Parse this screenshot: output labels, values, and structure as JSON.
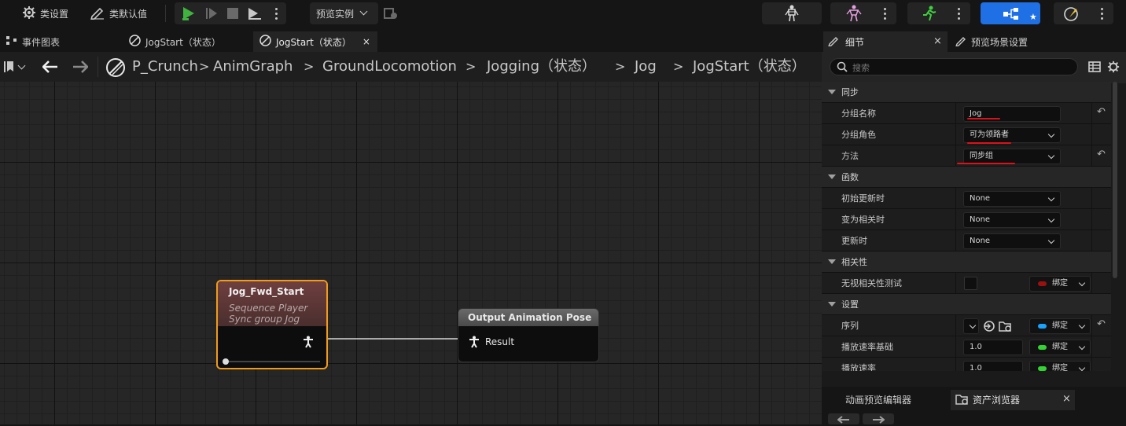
{
  "toolbar": {
    "class_settings": "类设置",
    "class_defaults": "类默认值",
    "preview_instance": "预览实例"
  },
  "tabs": {
    "event_graph": "事件图表",
    "tab1": "JogStart（状态）",
    "tab2": "JogStart（状态）",
    "tab2_close": "×"
  },
  "breadcrumb": {
    "items": [
      "P_Crunch",
      "AnimGraph",
      "GroundLocomotion",
      "Jogging（状态）",
      "Jog",
      "JogStart（状态）"
    ],
    "separator": ">"
  },
  "graph": {
    "node_player": {
      "title": "Jog_Fwd_Start",
      "subtitle1": "Sequence Player",
      "subtitle2": "Sync group Jog"
    },
    "node_output": {
      "title": "Output Animation Pose",
      "pin": "Result"
    }
  },
  "details": {
    "tab_details": "细节",
    "tab_close": "×",
    "tab_preview": "预览场景设置",
    "search_placeholder": "搜索",
    "sections": {
      "sync": "同步",
      "functions": "函数",
      "relevancy": "相关性",
      "settings": "设置"
    },
    "rows": {
      "group_name": {
        "label": "分组名称",
        "value": "Jog"
      },
      "group_role": {
        "label": "分组角色",
        "value": "可为领路者"
      },
      "method": {
        "label": "方法",
        "value": "同步组"
      },
      "on_initial_update": {
        "label": "初始更新时",
        "value": "None"
      },
      "on_become_relevant": {
        "label": "变为相关时",
        "value": "None"
      },
      "on_update": {
        "label": "更新时",
        "value": "None"
      },
      "ignore_relevancy": {
        "label": "无视相关性测试",
        "bind": "绑定"
      },
      "sequence": {
        "label": "序列",
        "bind": "绑定"
      },
      "play_rate_basis": {
        "label": "播放速率基础",
        "value": "1.0",
        "bind": "绑定"
      },
      "play_rate": {
        "label": "播放速率",
        "value": "1.0",
        "bind": "绑定"
      }
    }
  },
  "bottom": {
    "tab_anim_preview": "动画预览编辑器",
    "tab_content_browser": "资产浏览器",
    "close": "×"
  },
  "colors": {
    "accent_blue": "#1f6fe5",
    "play_green": "#3fb23f",
    "node_border_orange": "#f29a1a",
    "annotation_red": "#e0101a",
    "pin_red": "#9b1010",
    "pin_blue": "#1aa2ff",
    "pin_green": "#34d234"
  }
}
